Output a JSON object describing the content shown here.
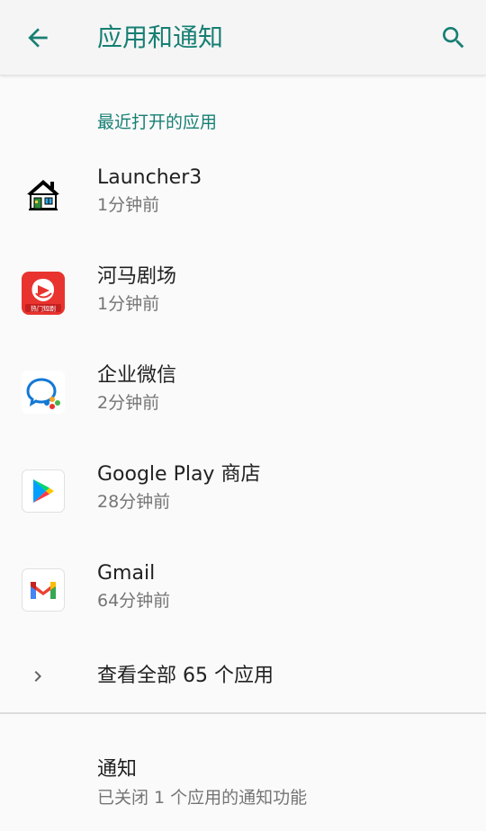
{
  "header": {
    "title": "应用和通知",
    "accent": "#167f73"
  },
  "recent": {
    "section_title": "最近打开的应用",
    "apps": [
      {
        "name": "Launcher3",
        "time": "1分钟前",
        "icon": "launcher3-house-icon"
      },
      {
        "name": "河马剧场",
        "time": "1分钟前",
        "icon": "hema-theater-icon",
        "icon_badge": "热门短剧"
      },
      {
        "name": "企业微信",
        "time": "2分钟前",
        "icon": "wecom-icon"
      },
      {
        "name": "Google Play 商店",
        "time": "28分钟前",
        "icon": "google-play-icon"
      },
      {
        "name": "Gmail",
        "time": "64分钟前",
        "icon": "gmail-icon"
      }
    ]
  },
  "see_all": {
    "label": "查看全部 65 个应用"
  },
  "notifications": {
    "title": "通知",
    "summary": "已关闭 1 个应用的通知功能"
  }
}
